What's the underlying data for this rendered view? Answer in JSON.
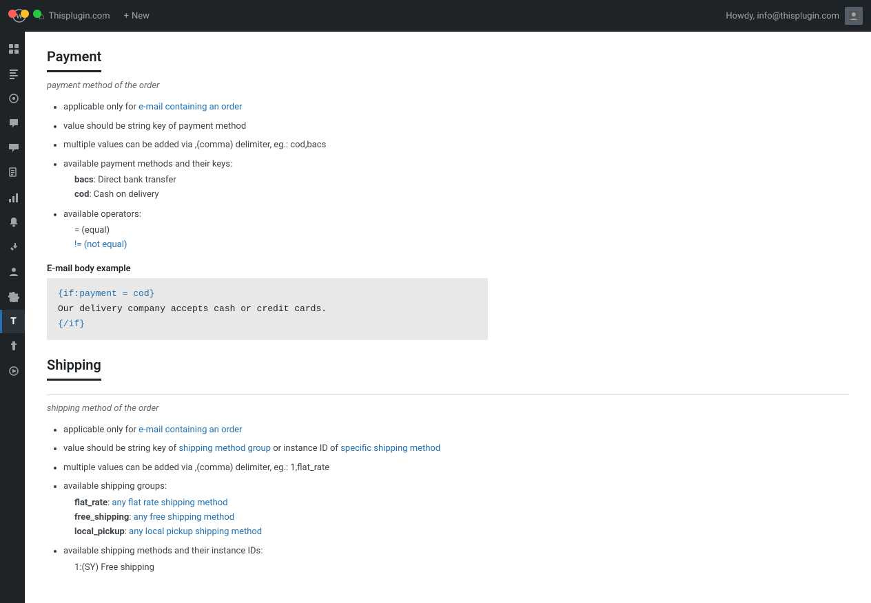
{
  "window": {
    "traffic_lights": [
      "red",
      "yellow",
      "green"
    ]
  },
  "admin_bar": {
    "wp_logo": "⊕",
    "site_name": "Thisplugin.com",
    "new_label": "New",
    "howdy": "Howdy, info@thisplugin.com"
  },
  "sidebar": {
    "items": [
      {
        "name": "dashboard-icon",
        "icon": "⊞",
        "active": false
      },
      {
        "name": "posts-icon",
        "icon": "✎",
        "active": false
      },
      {
        "name": "pin-icon",
        "icon": "◎",
        "active": false
      },
      {
        "name": "comments-icon",
        "icon": "💬",
        "active": false
      },
      {
        "name": "woocommerce-icon",
        "icon": "🛒",
        "active": false
      },
      {
        "name": "pages-icon",
        "icon": "📄",
        "active": false
      },
      {
        "name": "analytics-icon",
        "icon": "📊",
        "active": false
      },
      {
        "name": "megaphone-icon",
        "icon": "📢",
        "active": false
      },
      {
        "name": "tools-icon",
        "icon": "🔧",
        "active": false
      },
      {
        "name": "user-icon",
        "icon": "👤",
        "active": false
      },
      {
        "name": "settings-icon",
        "icon": "⚙",
        "active": false
      },
      {
        "name": "plugin-t-icon",
        "icon": "T",
        "active": true
      },
      {
        "name": "puzzle-icon",
        "icon": "🧩",
        "active": false
      },
      {
        "name": "play-icon",
        "icon": "▶",
        "active": false
      }
    ]
  },
  "payment_section": {
    "title": "Payment",
    "subtitle": "payment method of the order",
    "bullets": [
      {
        "text": "applicable only for e-mail containing an order",
        "has_link": true,
        "link_text": "e-mail containing an order",
        "link_start": 22
      },
      {
        "text": "value should be string key of payment method"
      },
      {
        "text": "multiple values can be added via ,(comma) delimiter, eg.: cod,bacs"
      },
      {
        "text": "available payment methods and their keys:",
        "sub_items": [
          {
            "bold": "bacs",
            "rest": ": Direct bank transfer"
          },
          {
            "bold": "cod",
            "rest": ": Cash on delivery"
          }
        ]
      },
      {
        "text": "available operators:",
        "sub_items": [
          {
            "text": "= (equal)"
          },
          {
            "text": "!= (not equal)",
            "has_link": true
          }
        ]
      }
    ],
    "example_label": "E-mail body example",
    "code_lines": [
      "{if:payment = cod}",
      "Our delivery company accepts cash or credit cards.",
      "{/if}"
    ]
  },
  "shipping_section": {
    "title": "Shipping",
    "subtitle": "shipping method of the order",
    "bullets": [
      {
        "text": "applicable only for e-mail containing an order",
        "has_link": true
      },
      {
        "text": "value should be string key of shipping method group or instance ID of specific shipping method",
        "has_link": true
      },
      {
        "text": "multiple values can be added via ,(comma) delimiter, eg.: 1,flat_rate"
      },
      {
        "text": "available shipping groups:",
        "sub_items": [
          {
            "bold": "flat_rate",
            "rest": ": any flat rate shipping method",
            "rest_link": true
          },
          {
            "bold": "free_shipping",
            "rest": ": any free shipping method",
            "rest_link": true
          },
          {
            "bold": "local_pickup",
            "rest": ": any local pickup shipping method",
            "rest_link": true
          }
        ]
      },
      {
        "text": "available shipping methods and their instance IDs:",
        "sub_items": [
          {
            "text": "1:(SY) Free shipping"
          }
        ]
      }
    ]
  }
}
